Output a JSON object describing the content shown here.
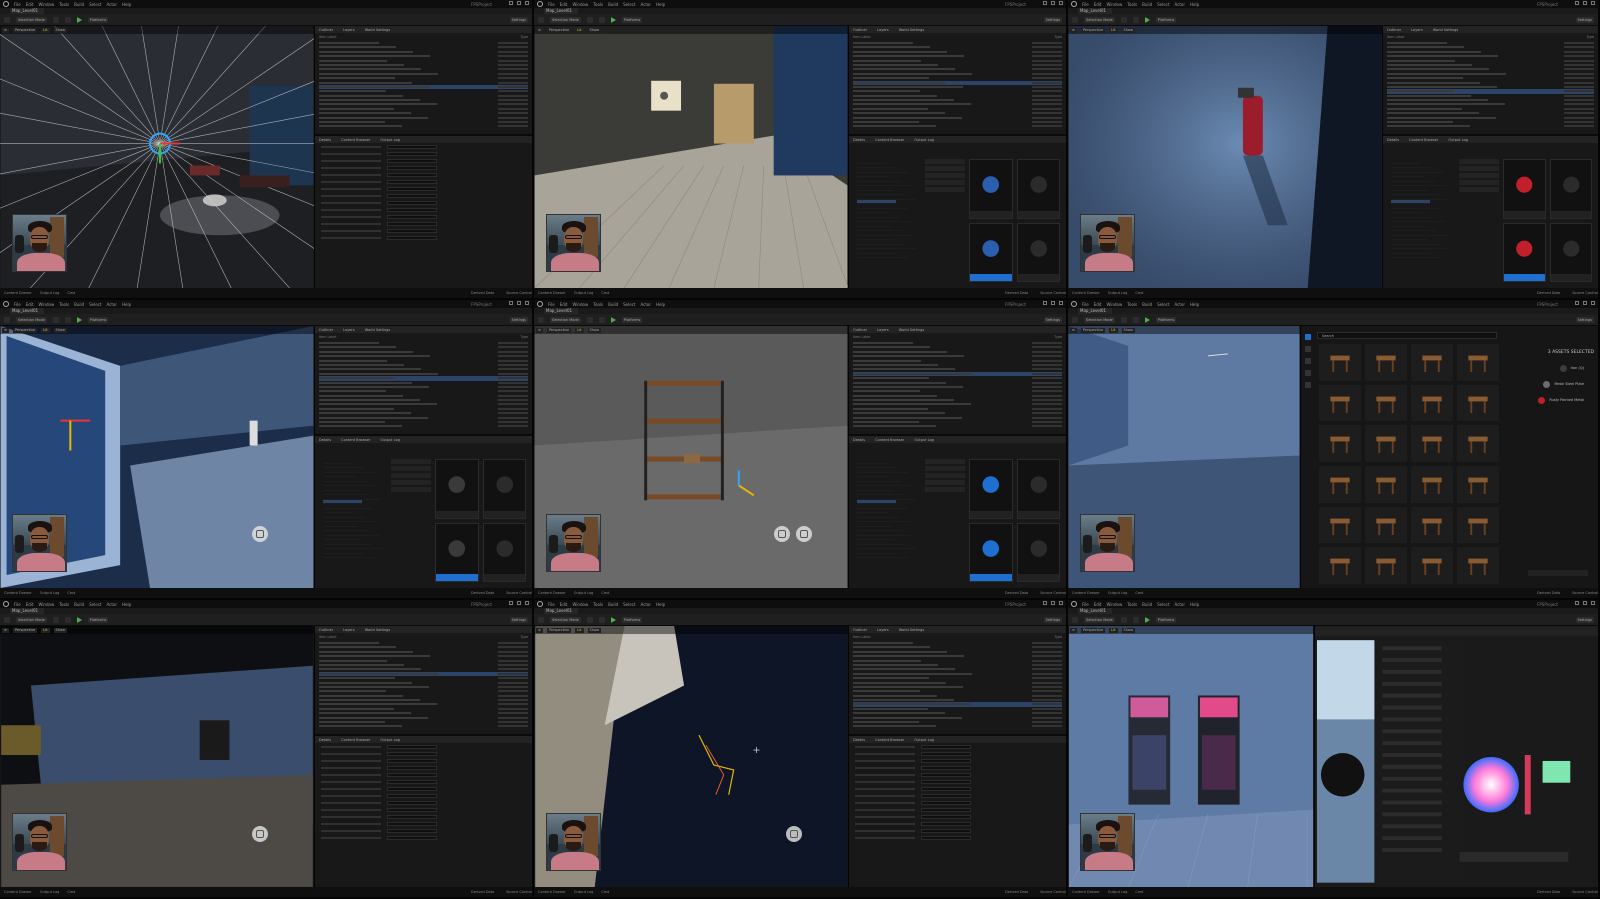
{
  "editor": {
    "menu": [
      "File",
      "Edit",
      "Window",
      "Tools",
      "Build",
      "Select",
      "Actor",
      "Help"
    ],
    "map_tab": "Map_Level01",
    "project": "FPSProject",
    "toolbar": {
      "selection_mode": "Selection Mode",
      "platforms": "Platforms",
      "settings": "Settings"
    },
    "viewport_bar": {
      "perspective": "Perspective",
      "lit": "Lit",
      "show": "Show"
    },
    "outliner_tabs": [
      "Outliner",
      "Layers",
      "World Settings"
    ],
    "outliner_cols": {
      "label": "Item Label",
      "type": "Type"
    },
    "details_tabs": [
      "Details",
      "World Settings"
    ],
    "browser_tabs": [
      "Content Browser",
      "Output Log"
    ],
    "status": {
      "content_drawer": "Content Drawer",
      "output_log": "Output Log",
      "cmd": "Cmd",
      "derived": "Derived Data",
      "source": "Source Control"
    }
  },
  "panels": [
    {
      "id": "p1",
      "scene": "lights"
    },
    {
      "id": "p2",
      "scene": "wallpanel"
    },
    {
      "id": "p3",
      "scene": "extinguisher"
    },
    {
      "id": "p4",
      "scene": "window"
    },
    {
      "id": "p5",
      "scene": "shelf"
    },
    {
      "id": "p6",
      "scene": "furniture"
    },
    {
      "id": "p7",
      "scene": "dark_room"
    },
    {
      "id": "p8",
      "scene": "chair"
    },
    {
      "id": "p9",
      "scene": "arcade"
    }
  ],
  "place_panel": {
    "search_placeholder": "Search",
    "selected_count": "3 ASSETS SELECTED",
    "materials": [
      "Iron (Q)",
      "Metal Steel Plate",
      "Rusty Painted Metal"
    ],
    "mat_colors": [
      "#3c3c3c",
      "#6d6d6d",
      "#c0202a"
    ]
  },
  "colors": {
    "accent": "#1f6fd1",
    "selection": "#2b4468",
    "lit": "#e5c33a",
    "play": "#4cae4c"
  }
}
